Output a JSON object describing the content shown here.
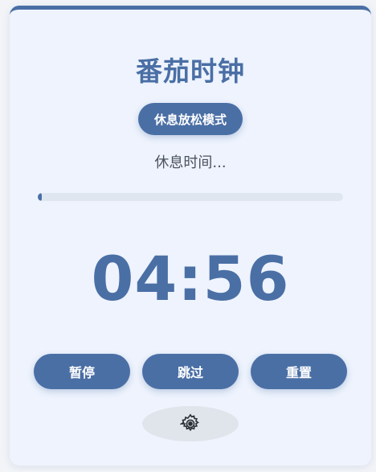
{
  "app": {
    "title": "番茄时钟"
  },
  "mode": {
    "label": "休息放松模式"
  },
  "status": {
    "text": "休息时间..."
  },
  "progress": {
    "fraction": 0.013
  },
  "timer": {
    "display": "04:56"
  },
  "controls": {
    "pause_label": "暂停",
    "skip_label": "跳过",
    "reset_label": "重置",
    "settings_icon": "gear-icon"
  },
  "colors": {
    "accent": "#4a6fa5",
    "card_background": "#eef3fd",
    "track": "#dfe6f0"
  }
}
